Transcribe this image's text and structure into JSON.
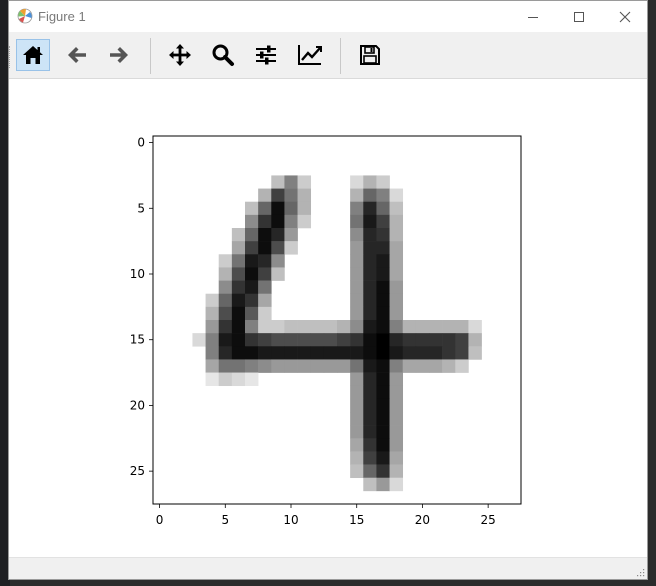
{
  "window": {
    "title": "Figure 1"
  },
  "toolbar": {
    "buttons": [
      {
        "name": "home-button",
        "icon": "home-icon",
        "tooltip": "Reset original view"
      },
      {
        "name": "back-button",
        "icon": "arrow-left-icon",
        "tooltip": "Back to previous view"
      },
      {
        "name": "forward-button",
        "icon": "arrow-right-icon",
        "tooltip": "Forward to next view"
      },
      {
        "name": "pan-button",
        "icon": "move-icon",
        "tooltip": "Pan axes"
      },
      {
        "name": "zoom-button",
        "icon": "magnifier-icon",
        "tooltip": "Zoom to rectangle"
      },
      {
        "name": "subplots-button",
        "icon": "sliders-icon",
        "tooltip": "Configure subplots"
      },
      {
        "name": "customize-button",
        "icon": "chart-line-icon",
        "tooltip": "Edit axis, curve and image parameters"
      },
      {
        "name": "save-button",
        "icon": "floppy-disk-icon",
        "tooltip": "Save the figure"
      }
    ],
    "active": "home-button"
  },
  "chart_data": {
    "type": "heatmap",
    "description_colormap": "gray_r",
    "xlim": [
      -0.5,
      27.5
    ],
    "ylim": [
      27.5,
      -0.5
    ],
    "xticks": [
      0,
      5,
      10,
      15,
      20,
      25
    ],
    "yticks": [
      0,
      5,
      10,
      15,
      20,
      25
    ],
    "xtick_labels": [
      "0",
      "5",
      "10",
      "15",
      "20",
      "25"
    ],
    "ytick_labels": [
      "0",
      "5",
      "10",
      "15",
      "20",
      "25"
    ],
    "title": "",
    "xlabel": "",
    "ylabel": "",
    "grid": false,
    "rows": 28,
    "cols": 28,
    "nonzero_pixels": [
      [
        3,
        9,
        0.25
      ],
      [
        3,
        10,
        0.5
      ],
      [
        3,
        11,
        0.2
      ],
      [
        3,
        15,
        0.15
      ],
      [
        3,
        16,
        0.3
      ],
      [
        3,
        17,
        0.2
      ],
      [
        4,
        8,
        0.3
      ],
      [
        4,
        9,
        0.75
      ],
      [
        4,
        10,
        0.55
      ],
      [
        4,
        11,
        0.3
      ],
      [
        4,
        15,
        0.3
      ],
      [
        4,
        16,
        0.6
      ],
      [
        4,
        17,
        0.5
      ],
      [
        4,
        18,
        0.15
      ],
      [
        5,
        7,
        0.25
      ],
      [
        5,
        8,
        0.6
      ],
      [
        5,
        9,
        0.95
      ],
      [
        5,
        10,
        0.6
      ],
      [
        5,
        11,
        0.3
      ],
      [
        5,
        15,
        0.5
      ],
      [
        5,
        16,
        0.85
      ],
      [
        5,
        17,
        0.6
      ],
      [
        5,
        18,
        0.25
      ],
      [
        6,
        7,
        0.45
      ],
      [
        6,
        8,
        0.8
      ],
      [
        6,
        9,
        0.95
      ],
      [
        6,
        10,
        0.5
      ],
      [
        6,
        11,
        0.2
      ],
      [
        6,
        15,
        0.55
      ],
      [
        6,
        16,
        0.9
      ],
      [
        6,
        17,
        0.75
      ],
      [
        6,
        18,
        0.3
      ],
      [
        7,
        6,
        0.25
      ],
      [
        7,
        7,
        0.6
      ],
      [
        7,
        8,
        0.95
      ],
      [
        7,
        9,
        0.85
      ],
      [
        7,
        10,
        0.4
      ],
      [
        7,
        15,
        0.45
      ],
      [
        7,
        16,
        0.85
      ],
      [
        7,
        17,
        0.8
      ],
      [
        7,
        18,
        0.3
      ],
      [
        8,
        6,
        0.35
      ],
      [
        8,
        7,
        0.75
      ],
      [
        8,
        8,
        0.95
      ],
      [
        8,
        9,
        0.7
      ],
      [
        8,
        10,
        0.2
      ],
      [
        8,
        15,
        0.4
      ],
      [
        8,
        16,
        0.85
      ],
      [
        8,
        17,
        0.85
      ],
      [
        8,
        18,
        0.35
      ],
      [
        9,
        5,
        0.2
      ],
      [
        9,
        6,
        0.55
      ],
      [
        9,
        7,
        0.9
      ],
      [
        9,
        8,
        0.85
      ],
      [
        9,
        9,
        0.45
      ],
      [
        9,
        15,
        0.4
      ],
      [
        9,
        16,
        0.85
      ],
      [
        9,
        17,
        0.9
      ],
      [
        9,
        18,
        0.35
      ],
      [
        10,
        5,
        0.3
      ],
      [
        10,
        6,
        0.7
      ],
      [
        10,
        7,
        0.95
      ],
      [
        10,
        8,
        0.75
      ],
      [
        10,
        9,
        0.25
      ],
      [
        10,
        15,
        0.4
      ],
      [
        10,
        16,
        0.85
      ],
      [
        10,
        17,
        0.9
      ],
      [
        10,
        18,
        0.35
      ],
      [
        11,
        5,
        0.45
      ],
      [
        11,
        6,
        0.8
      ],
      [
        11,
        7,
        0.9
      ],
      [
        11,
        8,
        0.55
      ],
      [
        11,
        15,
        0.4
      ],
      [
        11,
        16,
        0.85
      ],
      [
        11,
        17,
        0.95
      ],
      [
        11,
        18,
        0.4
      ],
      [
        12,
        4,
        0.2
      ],
      [
        12,
        5,
        0.6
      ],
      [
        12,
        6,
        0.9
      ],
      [
        12,
        7,
        0.8
      ],
      [
        12,
        8,
        0.35
      ],
      [
        12,
        15,
        0.4
      ],
      [
        12,
        16,
        0.85
      ],
      [
        12,
        17,
        0.95
      ],
      [
        12,
        18,
        0.4
      ],
      [
        13,
        4,
        0.3
      ],
      [
        13,
        5,
        0.7
      ],
      [
        13,
        6,
        0.95
      ],
      [
        13,
        7,
        0.65
      ],
      [
        13,
        8,
        0.2
      ],
      [
        13,
        15,
        0.4
      ],
      [
        13,
        16,
        0.85
      ],
      [
        13,
        17,
        0.95
      ],
      [
        13,
        18,
        0.4
      ],
      [
        14,
        4,
        0.4
      ],
      [
        14,
        5,
        0.8
      ],
      [
        14,
        6,
        0.95
      ],
      [
        14,
        7,
        0.5
      ],
      [
        14,
        8,
        0.2
      ],
      [
        14,
        9,
        0.2
      ],
      [
        14,
        10,
        0.25
      ],
      [
        14,
        11,
        0.25
      ],
      [
        14,
        12,
        0.25
      ],
      [
        14,
        13,
        0.25
      ],
      [
        14,
        14,
        0.3
      ],
      [
        14,
        15,
        0.45
      ],
      [
        14,
        16,
        0.9
      ],
      [
        14,
        17,
        0.95
      ],
      [
        14,
        18,
        0.5
      ],
      [
        14,
        19,
        0.3
      ],
      [
        14,
        20,
        0.3
      ],
      [
        14,
        21,
        0.3
      ],
      [
        14,
        22,
        0.3
      ],
      [
        14,
        23,
        0.3
      ],
      [
        14,
        24,
        0.15
      ],
      [
        15,
        3,
        0.15
      ],
      [
        15,
        4,
        0.5
      ],
      [
        15,
        5,
        0.9
      ],
      [
        15,
        6,
        0.95
      ],
      [
        15,
        7,
        0.8
      ],
      [
        15,
        8,
        0.75
      ],
      [
        15,
        9,
        0.7
      ],
      [
        15,
        10,
        0.7
      ],
      [
        15,
        11,
        0.7
      ],
      [
        15,
        12,
        0.7
      ],
      [
        15,
        13,
        0.7
      ],
      [
        15,
        14,
        0.75
      ],
      [
        15,
        15,
        0.8
      ],
      [
        15,
        16,
        0.95
      ],
      [
        15,
        17,
        1.0
      ],
      [
        15,
        18,
        0.85
      ],
      [
        15,
        19,
        0.8
      ],
      [
        15,
        20,
        0.8
      ],
      [
        15,
        21,
        0.8
      ],
      [
        15,
        22,
        0.8
      ],
      [
        15,
        23,
        0.75
      ],
      [
        15,
        24,
        0.3
      ],
      [
        16,
        4,
        0.5
      ],
      [
        16,
        5,
        0.85
      ],
      [
        16,
        6,
        0.95
      ],
      [
        16,
        7,
        0.95
      ],
      [
        16,
        8,
        0.9
      ],
      [
        16,
        9,
        0.9
      ],
      [
        16,
        10,
        0.9
      ],
      [
        16,
        11,
        0.9
      ],
      [
        16,
        12,
        0.9
      ],
      [
        16,
        13,
        0.9
      ],
      [
        16,
        14,
        0.9
      ],
      [
        16,
        15,
        0.9
      ],
      [
        16,
        16,
        0.95
      ],
      [
        16,
        17,
        1.0
      ],
      [
        16,
        18,
        0.9
      ],
      [
        16,
        19,
        0.85
      ],
      [
        16,
        20,
        0.85
      ],
      [
        16,
        21,
        0.85
      ],
      [
        16,
        22,
        0.8
      ],
      [
        16,
        23,
        0.75
      ],
      [
        16,
        24,
        0.25
      ],
      [
        17,
        4,
        0.35
      ],
      [
        17,
        5,
        0.55
      ],
      [
        17,
        6,
        0.55
      ],
      [
        17,
        7,
        0.5
      ],
      [
        17,
        8,
        0.45
      ],
      [
        17,
        9,
        0.4
      ],
      [
        17,
        10,
        0.4
      ],
      [
        17,
        11,
        0.4
      ],
      [
        17,
        12,
        0.4
      ],
      [
        17,
        13,
        0.4
      ],
      [
        17,
        14,
        0.4
      ],
      [
        17,
        15,
        0.55
      ],
      [
        17,
        16,
        0.9
      ],
      [
        17,
        17,
        0.95
      ],
      [
        17,
        18,
        0.5
      ],
      [
        17,
        19,
        0.35
      ],
      [
        17,
        20,
        0.35
      ],
      [
        17,
        21,
        0.35
      ],
      [
        17,
        22,
        0.3
      ],
      [
        17,
        23,
        0.2
      ],
      [
        18,
        4,
        0.1
      ],
      [
        18,
        5,
        0.2
      ],
      [
        18,
        6,
        0.15
      ],
      [
        18,
        7,
        0.1
      ],
      [
        18,
        15,
        0.4
      ],
      [
        18,
        16,
        0.85
      ],
      [
        18,
        17,
        0.95
      ],
      [
        18,
        18,
        0.4
      ],
      [
        19,
        15,
        0.4
      ],
      [
        19,
        16,
        0.85
      ],
      [
        19,
        17,
        0.95
      ],
      [
        19,
        18,
        0.4
      ],
      [
        20,
        15,
        0.4
      ],
      [
        20,
        16,
        0.85
      ],
      [
        20,
        17,
        0.95
      ],
      [
        20,
        18,
        0.4
      ],
      [
        21,
        15,
        0.4
      ],
      [
        21,
        16,
        0.85
      ],
      [
        21,
        17,
        0.95
      ],
      [
        21,
        18,
        0.4
      ],
      [
        22,
        15,
        0.4
      ],
      [
        22,
        16,
        0.85
      ],
      [
        22,
        17,
        0.95
      ],
      [
        22,
        18,
        0.4
      ],
      [
        23,
        15,
        0.35
      ],
      [
        23,
        16,
        0.8
      ],
      [
        23,
        17,
        0.95
      ],
      [
        23,
        18,
        0.4
      ],
      [
        24,
        15,
        0.3
      ],
      [
        24,
        16,
        0.75
      ],
      [
        24,
        17,
        0.9
      ],
      [
        24,
        18,
        0.35
      ],
      [
        25,
        15,
        0.25
      ],
      [
        25,
        16,
        0.6
      ],
      [
        25,
        17,
        0.8
      ],
      [
        25,
        18,
        0.3
      ],
      [
        26,
        16,
        0.25
      ],
      [
        26,
        17,
        0.4
      ],
      [
        26,
        18,
        0.15
      ]
    ]
  },
  "colors": {
    "titlebar_text": "#7a7a7a",
    "toolbar_bg": "#f0f0f0",
    "active_button_bg": "#cde4f7",
    "active_button_border": "#99c2e8",
    "window_bg": "#ffffff"
  }
}
